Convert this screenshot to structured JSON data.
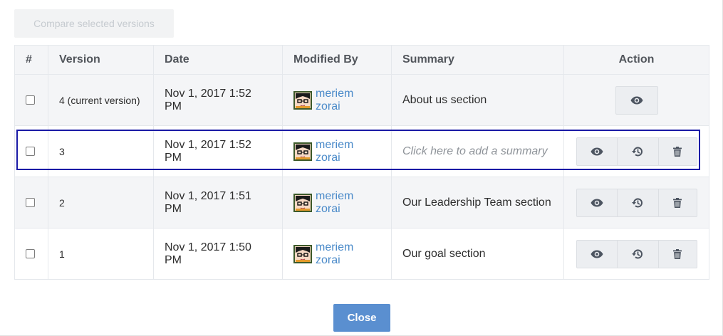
{
  "toolbar": {
    "compare_label": "Compare selected versions"
  },
  "table": {
    "headers": {
      "index": "#",
      "version": "Version",
      "date": "Date",
      "modified_by": "Modified By",
      "summary": "Summary",
      "action": "Action"
    },
    "rows": [
      {
        "version": "4 (current version)",
        "date": "Nov 1, 2017 1:52 PM",
        "user": "meriem zorai",
        "summary": "About us section"
      },
      {
        "version": "3",
        "date": "Nov 1, 2017 1:52 PM",
        "user": "meriem zorai",
        "summary_placeholder": "Click here to add a summary"
      },
      {
        "version": "2",
        "date": "Nov 1, 2017 1:51 PM",
        "user": "meriem zorai",
        "summary": "Our Leadership Team section"
      },
      {
        "version": "1",
        "date": "Nov 1, 2017 1:50 PM",
        "user": "meriem zorai",
        "summary": "Our goal section"
      }
    ]
  },
  "icons": {
    "view": "eye-icon",
    "restore": "history-icon",
    "delete": "trash-icon"
  },
  "colors": {
    "link": "#4a8ac9",
    "primary_button": "#5a8fd0",
    "highlight_border": "#1a1aa6"
  },
  "footer": {
    "close_label": "Close"
  }
}
